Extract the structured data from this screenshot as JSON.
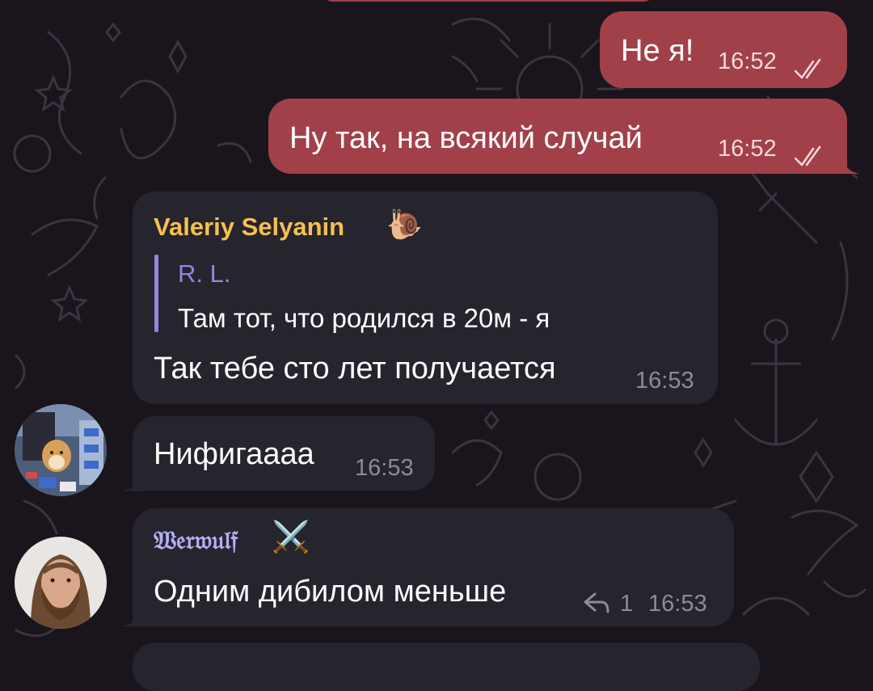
{
  "messages": [
    {
      "text": "Не я!",
      "time": "16:52"
    },
    {
      "text": "Ну так, на всякий случай",
      "time": "16:52"
    },
    {
      "sender": "Valeriy Selyanin",
      "sender_emoji": "🐌",
      "reply_name": "R. L.",
      "reply_text": "Там тот, что родился в 20м - я",
      "text": "Так тебе сто лет получается",
      "time": "16:53"
    },
    {
      "text": "Нифигаааа",
      "time": "16:53"
    },
    {
      "sender": "𝔚𝔢𝔯𝔴𝔲𝔩𝔣",
      "sender_emoji": "⚔️",
      "text": "Одним дибилом меньше",
      "reply_count": "1",
      "time": "16:53"
    }
  ],
  "colors": {
    "outgoing_bubble": "#a2404a",
    "incoming_bubble": "#26242d",
    "sender_valeriy": "#f5c04f",
    "sender_werwulf": "#b4aef5",
    "quote_accent": "#8f88e0"
  }
}
